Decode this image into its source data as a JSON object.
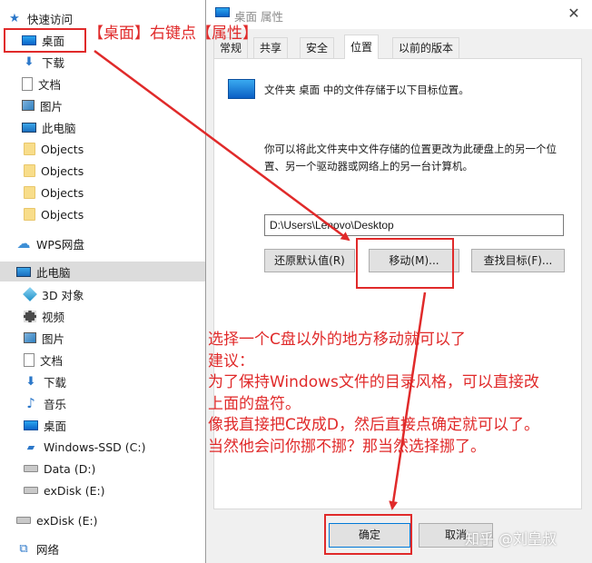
{
  "sidebar": {
    "items": [
      {
        "label": "快速访问",
        "icon": "star-icon"
      },
      {
        "label": "桌面",
        "icon": "desktop-icon"
      },
      {
        "label": "下载",
        "icon": "download-icon"
      },
      {
        "label": "文档",
        "icon": "document-icon"
      },
      {
        "label": "图片",
        "icon": "picture-icon"
      },
      {
        "label": "此电脑",
        "icon": "computer-icon"
      },
      {
        "label": "Objects",
        "icon": "folder-icon"
      },
      {
        "label": "Objects",
        "icon": "folder-icon"
      },
      {
        "label": "Objects",
        "icon": "folder-icon"
      },
      {
        "label": "Objects",
        "icon": "folder-icon"
      },
      {
        "label": "WPS网盘",
        "icon": "cloud-icon"
      },
      {
        "label": "此电脑",
        "icon": "computer-icon"
      },
      {
        "label": "3D 对象",
        "icon": "3d-objects-icon"
      },
      {
        "label": "视频",
        "icon": "video-icon"
      },
      {
        "label": "图片",
        "icon": "picture-icon"
      },
      {
        "label": "文档",
        "icon": "document-icon"
      },
      {
        "label": "下载",
        "icon": "download-icon"
      },
      {
        "label": "音乐",
        "icon": "music-icon"
      },
      {
        "label": "桌面",
        "icon": "desktop-icon"
      },
      {
        "label": "Windows-SSD (C:)",
        "icon": "windows-drive-icon"
      },
      {
        "label": "Data (D:)",
        "icon": "drive-icon"
      },
      {
        "label": "exDisk (E:)",
        "icon": "drive-icon"
      },
      {
        "label": "exDisk (E:)",
        "icon": "drive-icon"
      },
      {
        "label": "网络",
        "icon": "network-icon"
      }
    ]
  },
  "dialog": {
    "title": "桌面 属性",
    "tabs": [
      "常规",
      "共享",
      "安全",
      "位置",
      "以前的版本"
    ],
    "active_tab": "位置",
    "location_desc": "文件夹 桌面 中的文件存储于以下目标位置。",
    "move_desc": "你可以将此文件夹中文件存储的位置更改为此硬盘上的另一个位置、另一个驱动器或网络上的另一台计算机。",
    "path_value": "D:\\Users\\Lenovo\\Desktop",
    "buttons": {
      "restore": "还原默认值(R)",
      "move": "移动(M)...",
      "find": "查找目标(F)...",
      "ok": "确定",
      "cancel": "取消"
    }
  },
  "annotations": {
    "title": "【桌面】右键点【属性】",
    "lines": [
      "选择一个C盘以外的地方移动就可以了",
      "建议：",
      "为了保持Windows文件的目录风格，可以直接改",
      "上面的盘符。",
      "像我直接把C改成D，然后直接点确定就可以了。",
      "当然他会问你挪不挪？那当然选择挪了。"
    ],
    "color": "#e02a2a"
  },
  "watermark": "知乎 @刘皇叔"
}
